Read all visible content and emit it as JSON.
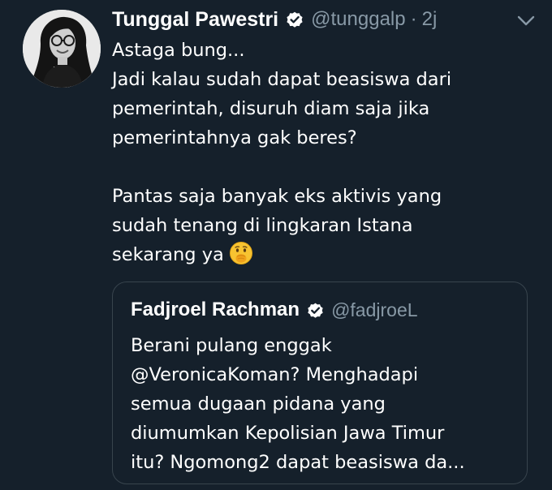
{
  "tweet": {
    "author_name": "Tunggal Pawestri",
    "author_handle": "@tunggalp",
    "separator": "·",
    "time": "2j",
    "verified": true,
    "avatar_icon": "profile-photo",
    "body_lines": [
      "Astaga bung...",
      "Jadi kalau sudah dapat beasiswa dari",
      "pemerintah, disuruh diam saja jika",
      "pemerintahnya gak beres?",
      "",
      "Pantas saja banyak eks aktivis yang",
      "sudah tenang di lingkaran Istana",
      "sekarang ya"
    ],
    "body_emoji": "shushing-face-emoji",
    "menu_icon": "chevron-down-icon"
  },
  "quoted_tweet": {
    "author_name": "Fadjroel Rachman",
    "author_handle": "@fadjroeL",
    "verified": true,
    "body_lines": [
      "Berani pulang enggak",
      "@VeronicaKoman? Menghadapi",
      "semua dugaan pidana yang",
      "diumumkan Kepolisian Jawa Timur",
      "itu? Ngomong2 dapat beasiswa da..."
    ]
  },
  "colors": {
    "background": "#15202b",
    "text_primary": "#ffffff",
    "text_secondary": "#8899a6",
    "border": "#38444d",
    "verified_badge": "#ffffff"
  }
}
